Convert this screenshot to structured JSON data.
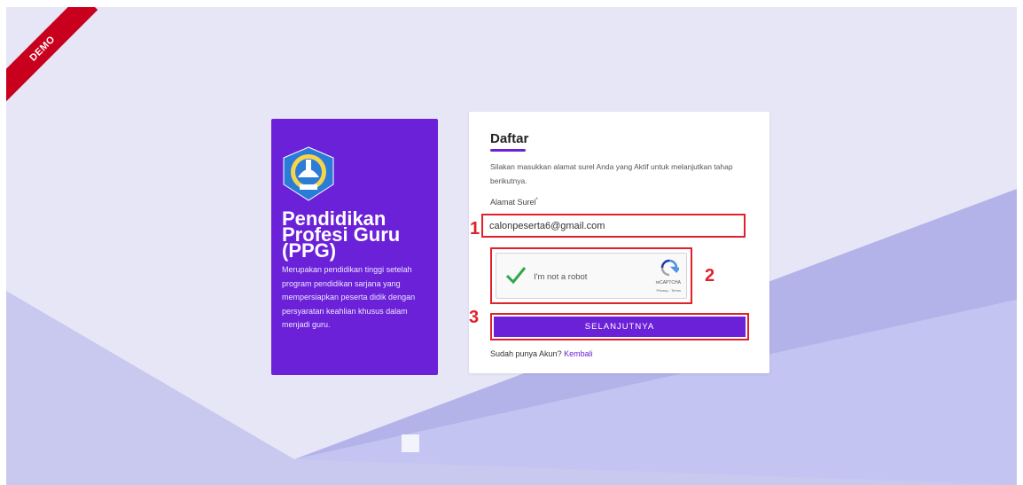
{
  "ribbon": {
    "label": "DEMO"
  },
  "info": {
    "title": "Pendidikan Profesi Guru (PPG)",
    "description": "Merupakan pendidikan tinggi setelah program pendidikan sarjana yang mempersiapkan peserta didik dengan persyaratan keahlian khusus dalam menjadi guru."
  },
  "form": {
    "title": "Daftar",
    "subtitle": "Silakan masukkan alamat surel Anda yang Aktif untuk melanjutkan tahap berikutnya.",
    "email_label": "Alamat Surel",
    "email_required_mark": "*",
    "email_value": "calonpeserta6@gmail.com",
    "captcha": {
      "label": "I'm not a robot",
      "brand": "reCAPTCHA",
      "privacy": "Privacy - Terms",
      "checked": true
    },
    "submit_label": "SELANJUTNYA",
    "account_prompt": "Sudah punya Akun?",
    "back_link": "Kembali"
  },
  "annotations": {
    "step1": "1",
    "step2": "2",
    "step3": "3"
  },
  "colors": {
    "primary": "#6b21d8",
    "annotation": "#e0202a",
    "ribbon": "#c8001e"
  },
  "icons": {
    "logo": "tut-wuri-handayani-logo",
    "check": "check-icon",
    "recaptcha": "recaptcha-icon"
  }
}
